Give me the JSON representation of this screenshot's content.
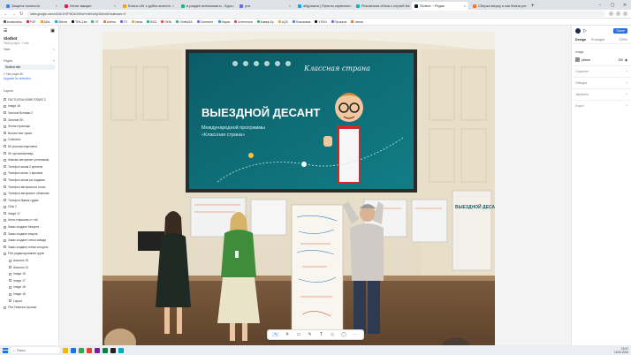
{
  "browser": {
    "tabs": [
      {
        "label": "Защита личность",
        "color": "#3b82f6",
        "active": false
      },
      {
        "label": "Игнат вакцин",
        "color": "#e11d48",
        "active": false
      },
      {
        "label": "Блогы сбт к рубля книготх",
        "color": "#f59e0b",
        "active": false
      },
      {
        "label": "в раздел военкоматы - Куро",
        "color": "#10b981",
        "active": false
      },
      {
        "label": "ути",
        "color": "#6366f1",
        "active": false
      },
      {
        "label": "абуражни | Пункты сервигов",
        "color": "#0ea5e9",
        "active": false
      },
      {
        "label": "Рекомполя сбнсв с сергей Бег",
        "color": "#14b8a6",
        "active": false
      },
      {
        "label": "Slotbot ~ Редак",
        "color": "#111827",
        "active": true
      },
      {
        "label": "Сборка мерку и как бизни рег",
        "color": "#f97316",
        "active": false
      }
    ],
    "url": "sites.google.com/u/0/d/1HIFXtDzO0ihaYmtb0ut/p/1lk/edit?authuser=0",
    "bookmarks": [
      {
        "label": "bookmarks",
        "color": "#555"
      },
      {
        "label": "POF",
        "color": "#e11d48"
      },
      {
        "label": "ADA",
        "color": "#f59e0b"
      },
      {
        "label": "OBrms",
        "color": "#0ea5e9"
      },
      {
        "label": "ТРА-Zan",
        "color": "#111"
      },
      {
        "label": "ПГ",
        "color": "#22c55e"
      },
      {
        "label": "Алёна",
        "color": "#f97316"
      },
      {
        "label": "ГП",
        "color": "#6366f1"
      },
      {
        "label": "Ideas",
        "color": "#eab308"
      },
      {
        "label": "BSO",
        "color": "#10b981"
      },
      {
        "label": "SKNI",
        "color": "#ef4444"
      },
      {
        "label": "GhelloSA",
        "color": "#14b8a6"
      },
      {
        "label": "Сентиент",
        "color": "#8b5cf6"
      },
      {
        "label": "Нарис",
        "color": "#0ea5e9"
      },
      {
        "label": "Алтпотоки",
        "color": "#f43f5e"
      },
      {
        "label": "Коваф Бу",
        "color": "#22c55e"
      },
      {
        "label": "AQS",
        "color": "#eab308"
      },
      {
        "label": "Поисковик",
        "color": "#3b82f6"
      },
      {
        "label": "YSVN",
        "color": "#111"
      },
      {
        "label": "Проекты",
        "color": "#6366f1"
      },
      {
        "label": "Ченал",
        "color": "#f97316"
      }
    ]
  },
  "left_panel": {
    "site_name": "Slotbot",
    "site_sub": "Твоя услуга · Fulls",
    "home_label": "Hide",
    "pages_label": "Pages",
    "current_page": "Slotbot site",
    "note": "2 Stat pages  tilt",
    "note_link": "Upgrade for unlimited",
    "layers_label": "Layers",
    "layers": [
      {
        "label": "FACTUOSA HOME STAKE 2",
        "indent": false
      },
      {
        "label": "Image 18",
        "indent": false
      },
      {
        "label": "Заголов Вставки 2",
        "indent": false
      },
      {
        "label": "Заголов SK",
        "indent": false
      },
      {
        "label": "Лепня страницы",
        "indent": false
      },
      {
        "label": "Вклоно вис тушке",
        "indent": false
      },
      {
        "label": "Collection",
        "indent": false
      },
      {
        "label": "Лё усихожи мартовна",
        "indent": false
      },
      {
        "label": "Лё ори вишньевед",
        "indent": false
      },
      {
        "label": "Киможе автормоет уновлимая",
        "indent": false
      },
      {
        "label": "Телефон кинов 2 крепеля",
        "indent": false
      },
      {
        "label": "Телефон кинос 1 вуловов",
        "indent": false
      },
      {
        "label": "Телефон кинов ры надмать",
        "indent": false
      },
      {
        "label": "Телефон автормолли оглан",
        "indent": false
      },
      {
        "label": "Телефон автормолл облачная",
        "indent": false
      },
      {
        "label": "Телефон бумаж тудам",
        "indent": false
      },
      {
        "label": "Click 2",
        "indent": false
      },
      {
        "label": "Image 17",
        "indent": false
      },
      {
        "label": "Анна старшина от гой",
        "indent": false
      },
      {
        "label": "Заказ создают безцета",
        "indent": false
      },
      {
        "label": "Заказ создают вокуля",
        "indent": false
      },
      {
        "label": "Заказ создают отвоя заводи",
        "indent": false
      },
      {
        "label": "Заказ создают ичник слецаль",
        "indent": false
      },
      {
        "label": "Flex редактирование групп",
        "indent": false
      },
      {
        "label": "Assoons 15",
        "indent": true
      },
      {
        "label": "Assoons 14",
        "indent": true
      },
      {
        "label": "Image 18",
        "indent": true
      },
      {
        "label": "Image 17",
        "indent": true
      },
      {
        "label": "Image 16",
        "indent": true
      },
      {
        "label": "Image 15",
        "indent": true
      },
      {
        "label": "Layout",
        "indent": true
      },
      {
        "label": "Flex Новичок кусочки",
        "indent": false
      }
    ]
  },
  "right_panel": {
    "tab_design": "Design",
    "tab_prototype": "Prototype",
    "zoom": "100%",
    "publish_label": "Share",
    "section_image": "Image",
    "image_name": "picture",
    "image_value": "Fill",
    "image_pct": "100",
    "props": [
      {
        "label": "Сокрытие",
        "value": "+"
      },
      {
        "label": "Обводка",
        "value": "+"
      },
      {
        "label": "Эффекты",
        "value": "+"
      },
      {
        "label": "Export",
        "value": "+"
      }
    ]
  },
  "photo": {
    "screen_title": "ВЫЕЗДНОЙ ДЕСАНТ",
    "screen_sub1": "Международной программы",
    "screen_sub2": "«Классная страна»",
    "screen_brand": "Классная страна",
    "poster_right": "ВЫЕЗДНОЙ ДЕСАНТ"
  },
  "taskbar": {
    "search_label": "Поиск",
    "time": "19:47",
    "date": "16.02.2024"
  },
  "colors": {
    "accent": "#2a6fdb",
    "screen_bg": "#0f6f78"
  }
}
